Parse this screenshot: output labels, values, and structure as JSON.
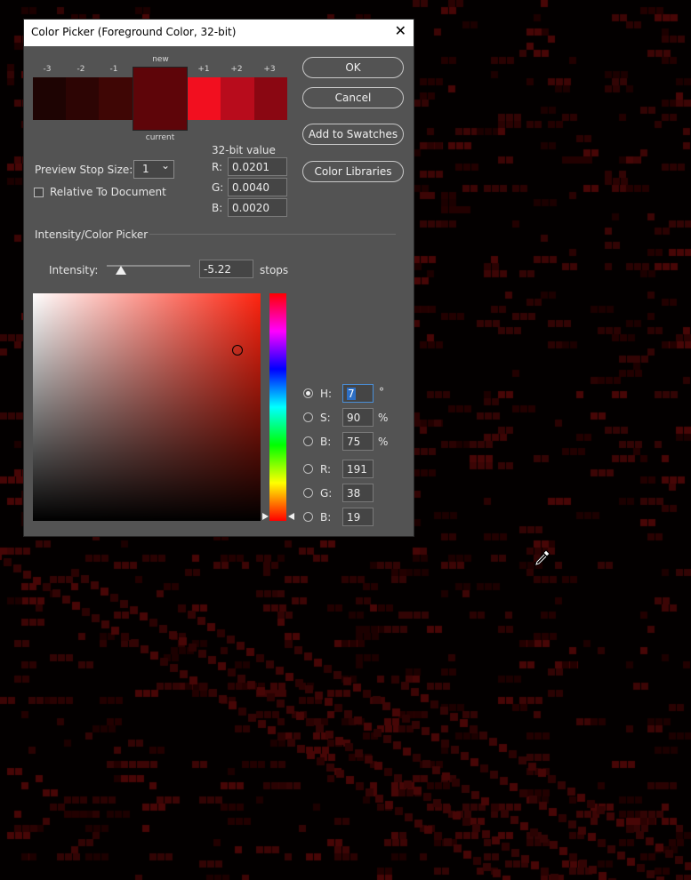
{
  "dialog": {
    "title": "Color Picker (Foreground Color, 32-bit)",
    "close_symbol": "✕",
    "stop_labels": [
      "-3",
      "-2",
      "-1",
      "new",
      "+1",
      "+2",
      "+3"
    ],
    "current_label": "current",
    "swatch_colors": {
      "m3": "#1e0403",
      "m2": "#2d0504",
      "m1": "#3f0605",
      "new": "#5e0509",
      "current": "#5e0509",
      "p1": "#f20f1f",
      "p2": "#b80c1c",
      "p3": "#8a0712"
    },
    "buttons": {
      "ok": "OK",
      "cancel": "Cancel",
      "add_to_swatches": "Add to Swatches",
      "color_libraries": "Color Libraries"
    },
    "preview_stop_size": {
      "label": "Preview Stop Size:",
      "value": "1",
      "chevron": "⌄"
    },
    "relative_to_document": {
      "label": "Relative To Document",
      "checked": false
    },
    "value_32bit": {
      "title": "32-bit value",
      "r_label": "R:",
      "r": "0.0201",
      "g_label": "G:",
      "g": "0.0040",
      "b_label": "B:",
      "b": "0.0020"
    },
    "intensity": {
      "section_title": "Intensity/Color Picker",
      "label": "Intensity:",
      "value": "-5.22",
      "unit": "stops",
      "slider_fraction": 0.17
    },
    "picker": {
      "field_cursor_s": 0.9,
      "field_cursor_b": 0.75,
      "hue_degrees": 7
    },
    "hsb_rgb": {
      "h_label": "H:",
      "h": "7",
      "h_unit": "°",
      "s_label": "S:",
      "s": "90",
      "s_unit": "%",
      "b_label": "B:",
      "b": "75",
      "b_unit": "%",
      "r_label": "R:",
      "r": "191",
      "g_label": "G:",
      "g": "38",
      "bb_label": "B:",
      "bb": "19",
      "selected": "H"
    }
  }
}
